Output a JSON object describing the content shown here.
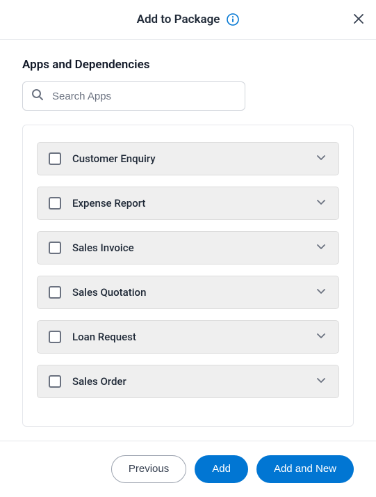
{
  "header": {
    "title": "Add to Package"
  },
  "section": {
    "title": "Apps and Dependencies"
  },
  "search": {
    "placeholder": "Search Apps"
  },
  "apps": {
    "items": [
      {
        "label": "Customer Enquiry"
      },
      {
        "label": "Expense Report"
      },
      {
        "label": "Sales Invoice"
      },
      {
        "label": "Sales Quotation"
      },
      {
        "label": "Loan Request"
      },
      {
        "label": "Sales Order"
      }
    ]
  },
  "footer": {
    "previous": "Previous",
    "add": "Add",
    "add_and_new": "Add and New"
  }
}
